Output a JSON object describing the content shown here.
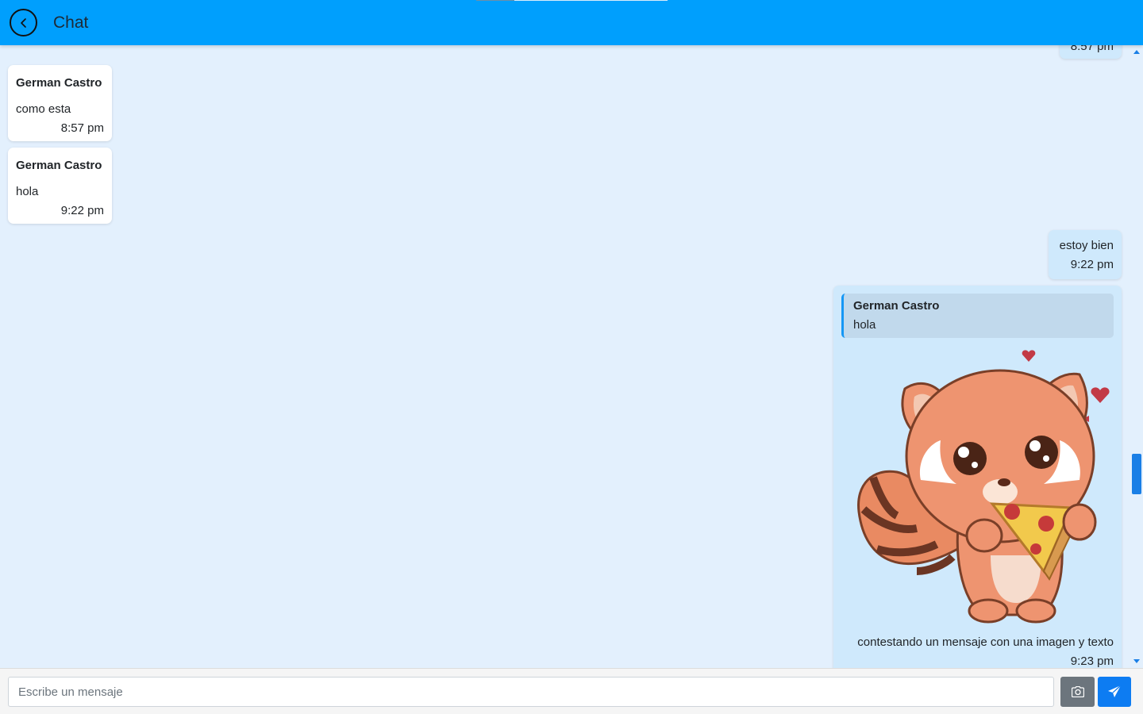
{
  "header": {
    "title": "Chat",
    "back_icon": "chevron-left-circle-icon",
    "bg_color": "#009ffd"
  },
  "messages": [
    {
      "direction": "out",
      "time": "8:57 pm",
      "partial": true
    },
    {
      "direction": "in",
      "sender": "German Castro",
      "text": "como esta",
      "time": "8:57 pm"
    },
    {
      "direction": "in",
      "sender": "German Castro",
      "text": "hola",
      "time": "9:22 pm"
    },
    {
      "direction": "out",
      "text": "estoy bien",
      "time": "9:22 pm"
    },
    {
      "direction": "out",
      "reply_to": {
        "sender": "German Castro",
        "text": "hola"
      },
      "image": "red-panda-eating-pizza-sticker",
      "text": "contestando un mensaje con una imagen y texto",
      "time": "9:23 pm"
    }
  ],
  "composer": {
    "placeholder": "Escribe un mensaje",
    "value": "",
    "camera_icon": "camera-icon",
    "send_icon": "paper-plane-icon"
  },
  "colors": {
    "chat_bg": "#e3f0fd",
    "incoming_bubble": "#ffffff",
    "outgoing_bubble": "#cfe9fc",
    "accent": "#0d7cf2"
  }
}
